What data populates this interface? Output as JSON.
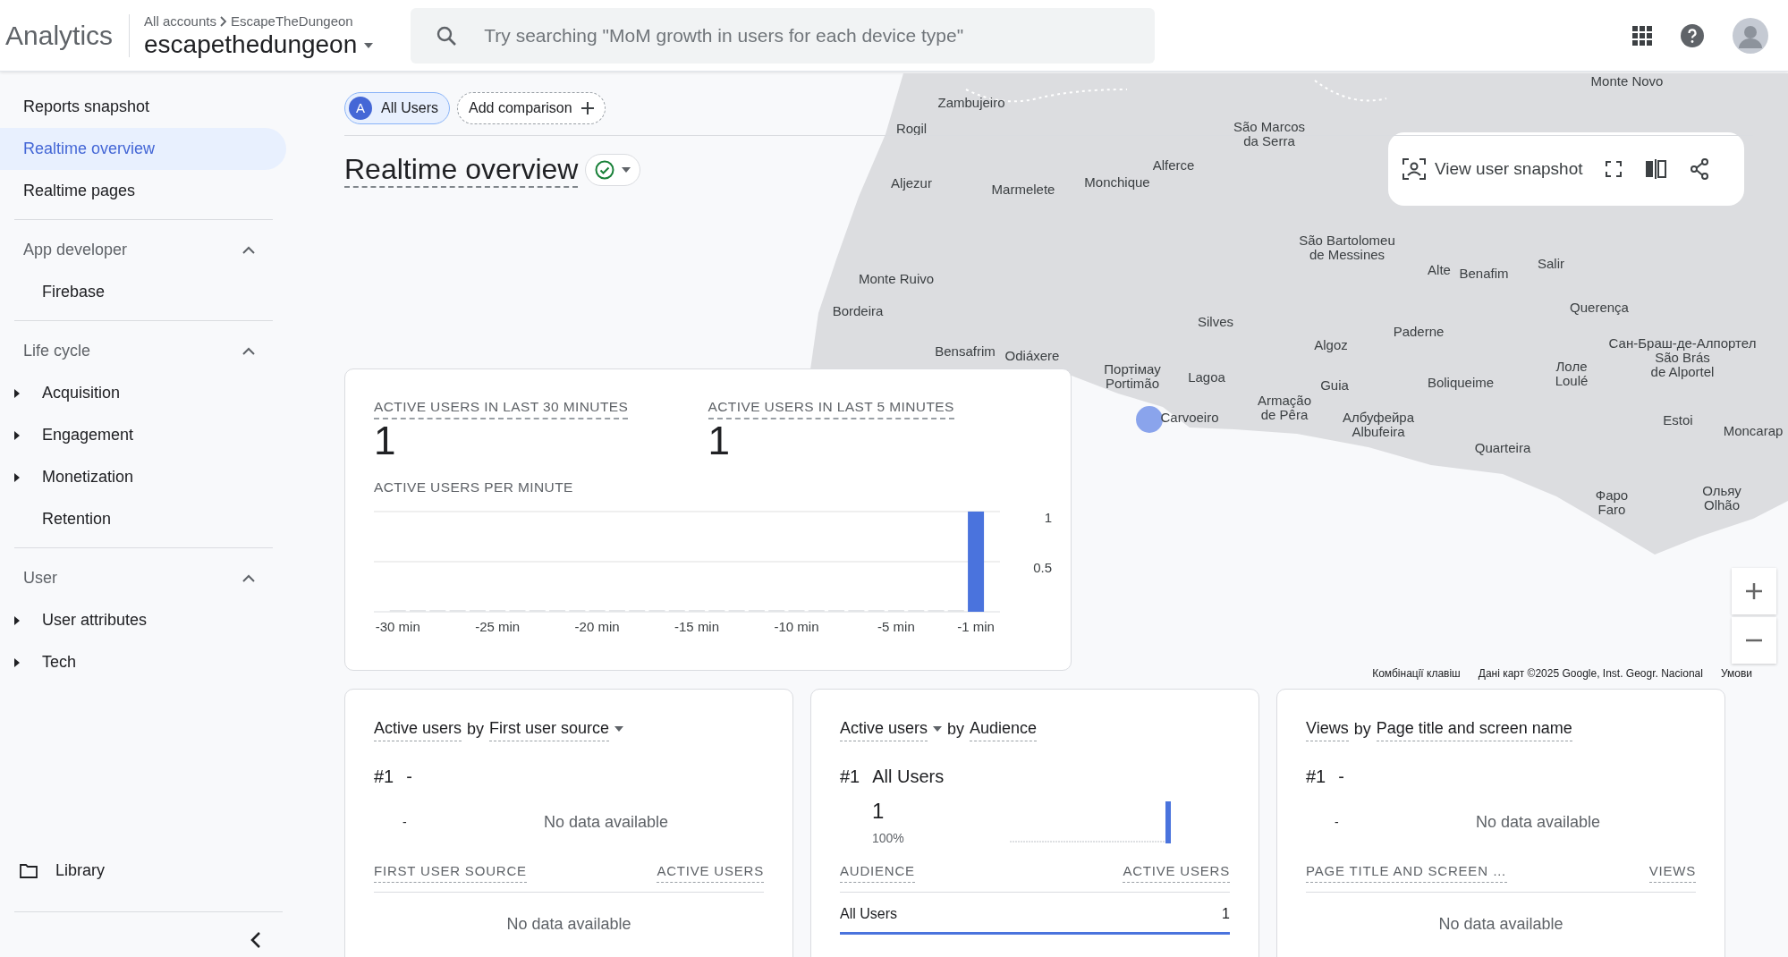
{
  "header": {
    "product": "Analytics",
    "breadcrumb": [
      "All accounts",
      "EscapeTheDungeon"
    ],
    "property": "escapethedungeon",
    "search": {
      "placeholder": "Try searching \"MoM growth in users for each device type\""
    }
  },
  "nav": [
    {
      "label": "Reports snapshot",
      "selected": false
    },
    {
      "label": "Realtime overview",
      "selected": true
    },
    {
      "label": "Realtime pages",
      "selected": false
    }
  ],
  "sidebar_sections": [
    {
      "title": "App developer",
      "expanded": true,
      "items": [
        {
          "label": "Firebase",
          "expandable": false
        }
      ]
    },
    {
      "title": "Life cycle",
      "expanded": true,
      "items": [
        {
          "label": "Acquisition",
          "expandable": true
        },
        {
          "label": "Engagement",
          "expandable": true
        },
        {
          "label": "Monetization",
          "expandable": true
        },
        {
          "label": "Retention",
          "expandable": false
        }
      ]
    },
    {
      "title": "User",
      "expanded": true,
      "items": [
        {
          "label": "User attributes",
          "expandable": true
        },
        {
          "label": "Tech",
          "expandable": true
        }
      ]
    }
  ],
  "library": "Library",
  "comparison": {
    "chip_letter": "A",
    "chip_label": "All Users",
    "add_label": "Add comparison"
  },
  "page_title": "Realtime overview",
  "snapshot_button": "View user snapshot",
  "map": {
    "labels": [
      {
        "lines": [
          "Monte Novo"
        ]
      },
      {
        "lines": [
          "Zambujeiro"
        ]
      },
      {
        "lines": [
          "Rogil"
        ]
      },
      {
        "lines": [
          "São Marcos",
          "da Serra"
        ]
      },
      {
        "lines": [
          "Alferce"
        ]
      },
      {
        "lines": [
          "Aljezur"
        ]
      },
      {
        "lines": [
          "Marmelete"
        ]
      },
      {
        "lines": [
          "Monchique"
        ]
      },
      {
        "lines": [
          "Monte Ruivo"
        ]
      },
      {
        "lines": [
          "São Bartolomeu",
          "de Messines"
        ]
      },
      {
        "lines": [
          "Alte"
        ]
      },
      {
        "lines": [
          "Benafim"
        ]
      },
      {
        "lines": [
          "Salir"
        ]
      },
      {
        "lines": [
          "Bordeira"
        ]
      },
      {
        "lines": [
          "Querença"
        ]
      },
      {
        "lines": [
          "Silves"
        ]
      },
      {
        "lines": [
          "Paderne"
        ]
      },
      {
        "lines": [
          "Bensafrim"
        ]
      },
      {
        "lines": [
          "Odiáxere"
        ]
      },
      {
        "lines": [
          "Портімау",
          "Portimão"
        ]
      },
      {
        "lines": [
          "Lagoa"
        ]
      },
      {
        "lines": [
          "Algoz"
        ]
      },
      {
        "lines": [
          "Guia"
        ]
      },
      {
        "lines": [
          "Boliqueime"
        ]
      },
      {
        "lines": [
          "Лоле",
          "Loulé"
        ]
      },
      {
        "lines": [
          "Сан-Браш-де-Алпортел",
          "São Brás",
          "de Alportel"
        ]
      },
      {
        "lines": [
          "Carvoeiro"
        ]
      },
      {
        "lines": [
          "Armação",
          "de Pêra"
        ]
      },
      {
        "lines": [
          "Албуфейра",
          "Albufeira"
        ]
      },
      {
        "lines": [
          "Estoi"
        ]
      },
      {
        "lines": [
          "Moncarap"
        ]
      },
      {
        "lines": [
          "Quarteira"
        ]
      },
      {
        "lines": [
          "Фаро",
          "Faro"
        ]
      },
      {
        "lines": [
          "Ольяу",
          "Olhão"
        ]
      }
    ],
    "attribution": [
      "Комбінації клавіш",
      "Дані карт ©2025 Google, Inst. Geogr. Nacional",
      "Умови"
    ]
  },
  "summary": {
    "metrics": [
      {
        "label": "ACTIVE USERS IN LAST 30 MINUTES",
        "value": "1"
      },
      {
        "label": "ACTIVE USERS IN LAST 5 MINUTES",
        "value": "1"
      }
    ],
    "chart_title": "ACTIVE USERS PER MINUTE",
    "chart_data": {
      "type": "bar",
      "x": [
        -30,
        -29,
        -28,
        -27,
        -26,
        -25,
        -24,
        -23,
        -22,
        -21,
        -20,
        -19,
        -18,
        -17,
        -16,
        -15,
        -14,
        -13,
        -12,
        -11,
        -10,
        -9,
        -8,
        -7,
        -6,
        -5,
        -4,
        -3,
        -2,
        -1
      ],
      "values": [
        0,
        0,
        0,
        0,
        0,
        0,
        0,
        0,
        0,
        0,
        0,
        0,
        0,
        0,
        0,
        0,
        0,
        0,
        0,
        0,
        0,
        0,
        0,
        0,
        0,
        0,
        0,
        0,
        0,
        1
      ],
      "xticks": [
        {
          "value": -30,
          "label": "-30 min"
        },
        {
          "value": -25,
          "label": "-25 min"
        },
        {
          "value": -20,
          "label": "-20 min"
        },
        {
          "value": -15,
          "label": "-15 min"
        },
        {
          "value": -10,
          "label": "-10 min"
        },
        {
          "value": -5,
          "label": "-5 min"
        },
        {
          "value": -1,
          "label": "-1 min"
        }
      ],
      "yticks": [
        {
          "value": 0.5,
          "label": "0.5"
        },
        {
          "value": 1,
          "label": "1"
        }
      ],
      "xlim": [
        -31.2,
        2.9
      ],
      "ylim": [
        -0.357,
        1.071
      ]
    }
  },
  "cards": [
    {
      "metric": "Active users",
      "metric_dropdown": false,
      "connector": "by",
      "dimension": "First user source",
      "dimension_dropdown": true,
      "rank": "#1",
      "top_name": "-",
      "top_value": "-",
      "sparkline": false,
      "no_data": "No data available",
      "columns": [
        "FIRST USER SOURCE",
        "ACTIVE USERS"
      ],
      "empty_text": "No data available"
    },
    {
      "metric": "Active users",
      "metric_dropdown": true,
      "connector": "by",
      "dimension": "Audience",
      "dimension_dropdown": false,
      "rank": "#1",
      "top_name": "All Users",
      "top_value": "1",
      "share": "100%",
      "sparkline": true,
      "columns": [
        "AUDIENCE",
        "ACTIVE USERS"
      ],
      "rows": [
        {
          "cells": [
            "All Users",
            "1"
          ],
          "level": 1
        }
      ]
    },
    {
      "metric": "Views",
      "metric_dropdown": false,
      "connector": "by",
      "dimension": "Page title and screen name",
      "dimension_dropdown": false,
      "rank": "#1",
      "top_name": "-",
      "top_value": "-",
      "sparkline": false,
      "no_data": "No data available",
      "columns": [
        "PAGE TITLE AND SCREEN …",
        "VIEWS"
      ],
      "empty_text": "No data available"
    }
  ]
}
